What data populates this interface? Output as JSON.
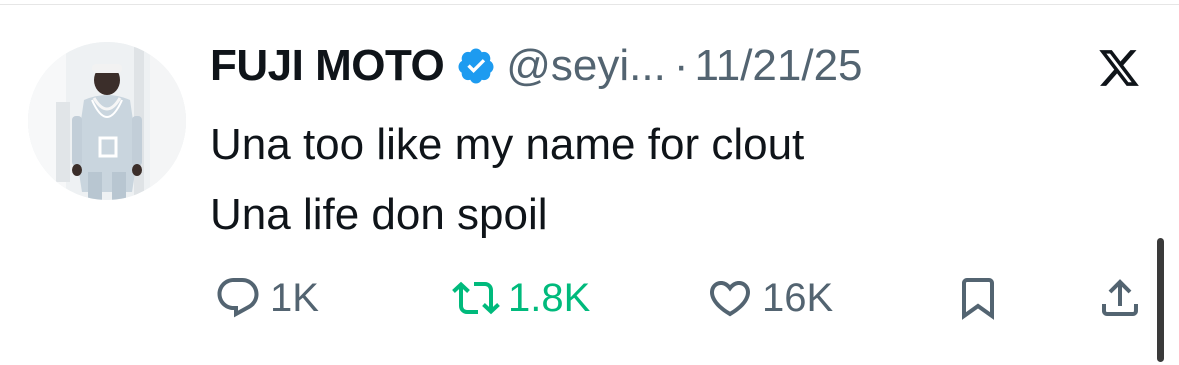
{
  "author": {
    "display_name": "FUJI MOTO",
    "verified_icon": "verified-badge-icon",
    "handle": "@seyi...",
    "separator": "·",
    "date": "11/21/25"
  },
  "platform_logo": "x-logo-icon",
  "tweet": {
    "lines": [
      "Una too like my name for clout",
      "Una life don spoil"
    ]
  },
  "actions": {
    "replies": "1K",
    "reposts": "1.8K",
    "likes": "16K"
  },
  "colors": {
    "text": "#0f1419",
    "muted": "#536471",
    "verified": "#1d9bf0",
    "repost": "#00ba7c"
  }
}
